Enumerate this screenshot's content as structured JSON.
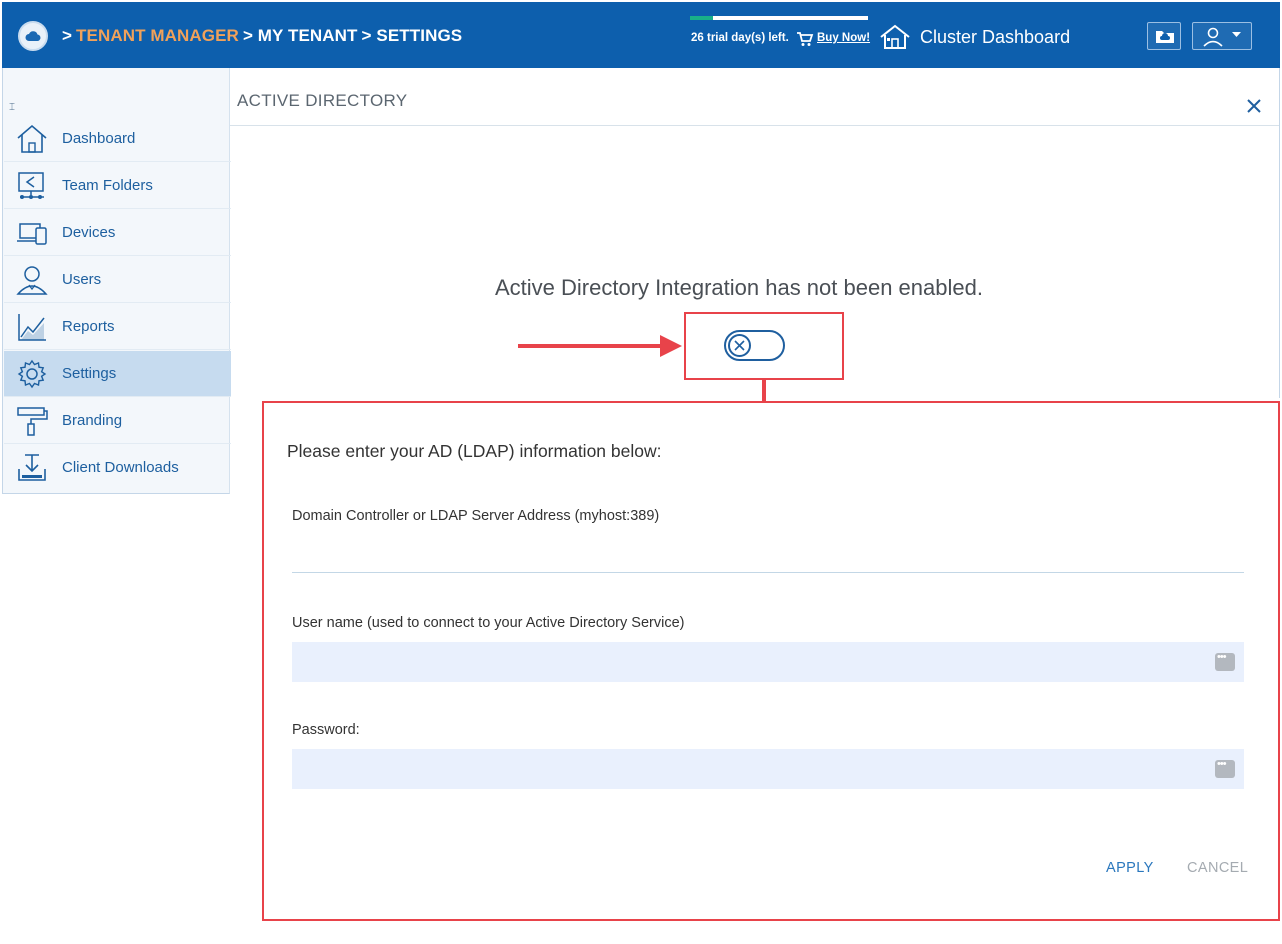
{
  "header": {
    "breadcrumb": [
      ">",
      "TENANT MANAGER",
      "> MY TENANT",
      "> SETTINGS"
    ],
    "trial_text": "26 trial day(s) left.",
    "trial_progress": 0.13,
    "buy_label": "Buy Now!",
    "cluster_label": "Cluster Dashboard",
    "colors": {
      "bar": "#0d5fad",
      "crumb_highlight": "#f0a15a",
      "progress": "#18b089"
    }
  },
  "sidebar": {
    "collapse_icon": "collapse-icon",
    "items": [
      {
        "label": "Dashboard",
        "icon": "home-icon"
      },
      {
        "label": "Team Folders",
        "icon": "shared-folder-icon"
      },
      {
        "label": "Devices",
        "icon": "devices-icon"
      },
      {
        "label": "Users",
        "icon": "user-icon"
      },
      {
        "label": "Reports",
        "icon": "chart-icon"
      },
      {
        "label": "Settings",
        "icon": "gear-icon",
        "active": true
      },
      {
        "label": "Branding",
        "icon": "paint-roller-icon"
      },
      {
        "label": "Client Downloads",
        "icon": "download-icon"
      }
    ]
  },
  "panel": {
    "title": "ACTIVE DIRECTORY",
    "status_message": "Active Directory Integration has not been enabled."
  },
  "form": {
    "heading": "Please enter your AD (LDAP) information below:",
    "ldap_label": "Domain Controller or LDAP Server Address (myhost:389)",
    "ldap_value": "",
    "username_label": "User name (used to connect to your Active Directory Service)",
    "username_value": "",
    "password_label": "Password:",
    "password_value": "",
    "apply_label": "APPLY",
    "cancel_label": "CANCEL"
  },
  "annotation_color": "#e8434a"
}
